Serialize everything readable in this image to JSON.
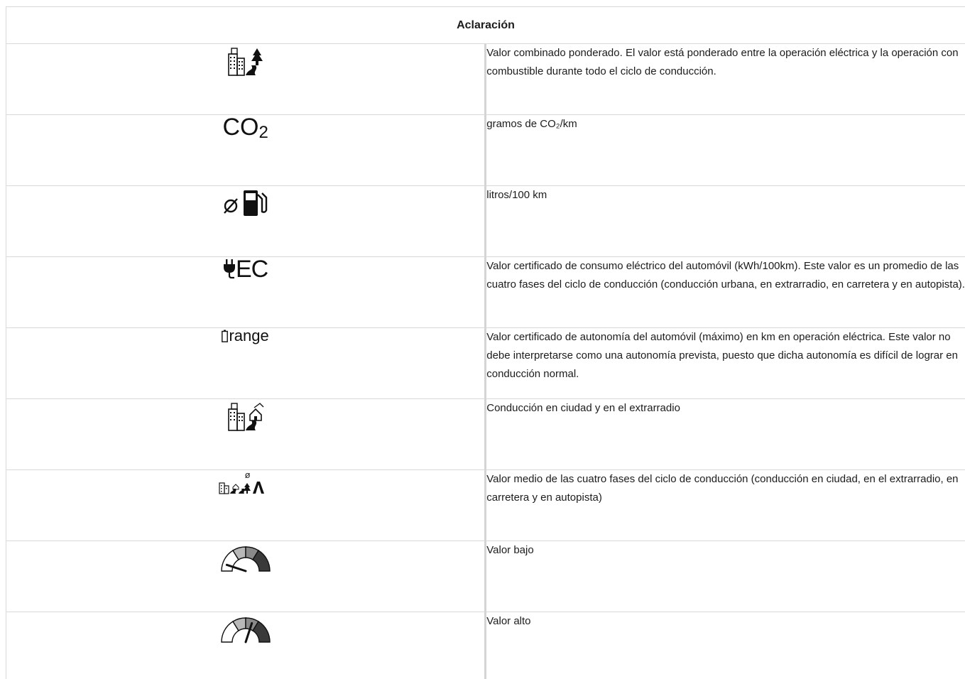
{
  "table": {
    "header": "Aclaración",
    "rows": [
      {
        "icon": "city-rural-combined-icon",
        "text": "Valor combinado ponderado. El valor está ponderado entre la operación eléctrica y la operación con combustible durante todo el ciclo de conducción."
      },
      {
        "icon": "co2-icon",
        "icon_text": "CO",
        "icon_sub": "2",
        "text": "gramos de CO₂/km"
      },
      {
        "icon": "fuel-average-icon",
        "text": "litros/100 km"
      },
      {
        "icon": "electric-consumption-icon",
        "icon_text": "EC",
        "text": "Valor certificado de consumo eléctrico del automóvil (kWh/100km). Este valor es un promedio de las cuatro fases del ciclo de conducción (conducción urba­na, en extrarradio, en carretera y en autopista)."
      },
      {
        "icon": "electric-range-icon",
        "icon_text": "range",
        "text": "Valor certificado de autonomía del automóvil (máximo) en km en operación eléctrica. Este valor no debe interpretarse como una autonomía prevista, puesto que dicha autonomía es difícil de lograr en conducción normal."
      },
      {
        "icon": "city-suburban-icon",
        "text": "Conducción en ciudad y en el extrarradio"
      },
      {
        "icon": "four-phase-average-icon",
        "icon_text": "ø",
        "text": "Valor medio de las cuatro fases del ciclo de conducción (conducción en ciudad, en el extrarradio, en carretera y en autopista)"
      },
      {
        "icon": "gauge-low-icon",
        "text": "Valor bajo",
        "level": 0.1
      },
      {
        "icon": "gauge-high-icon",
        "text": "Valor alto",
        "level": 0.6
      }
    ]
  }
}
